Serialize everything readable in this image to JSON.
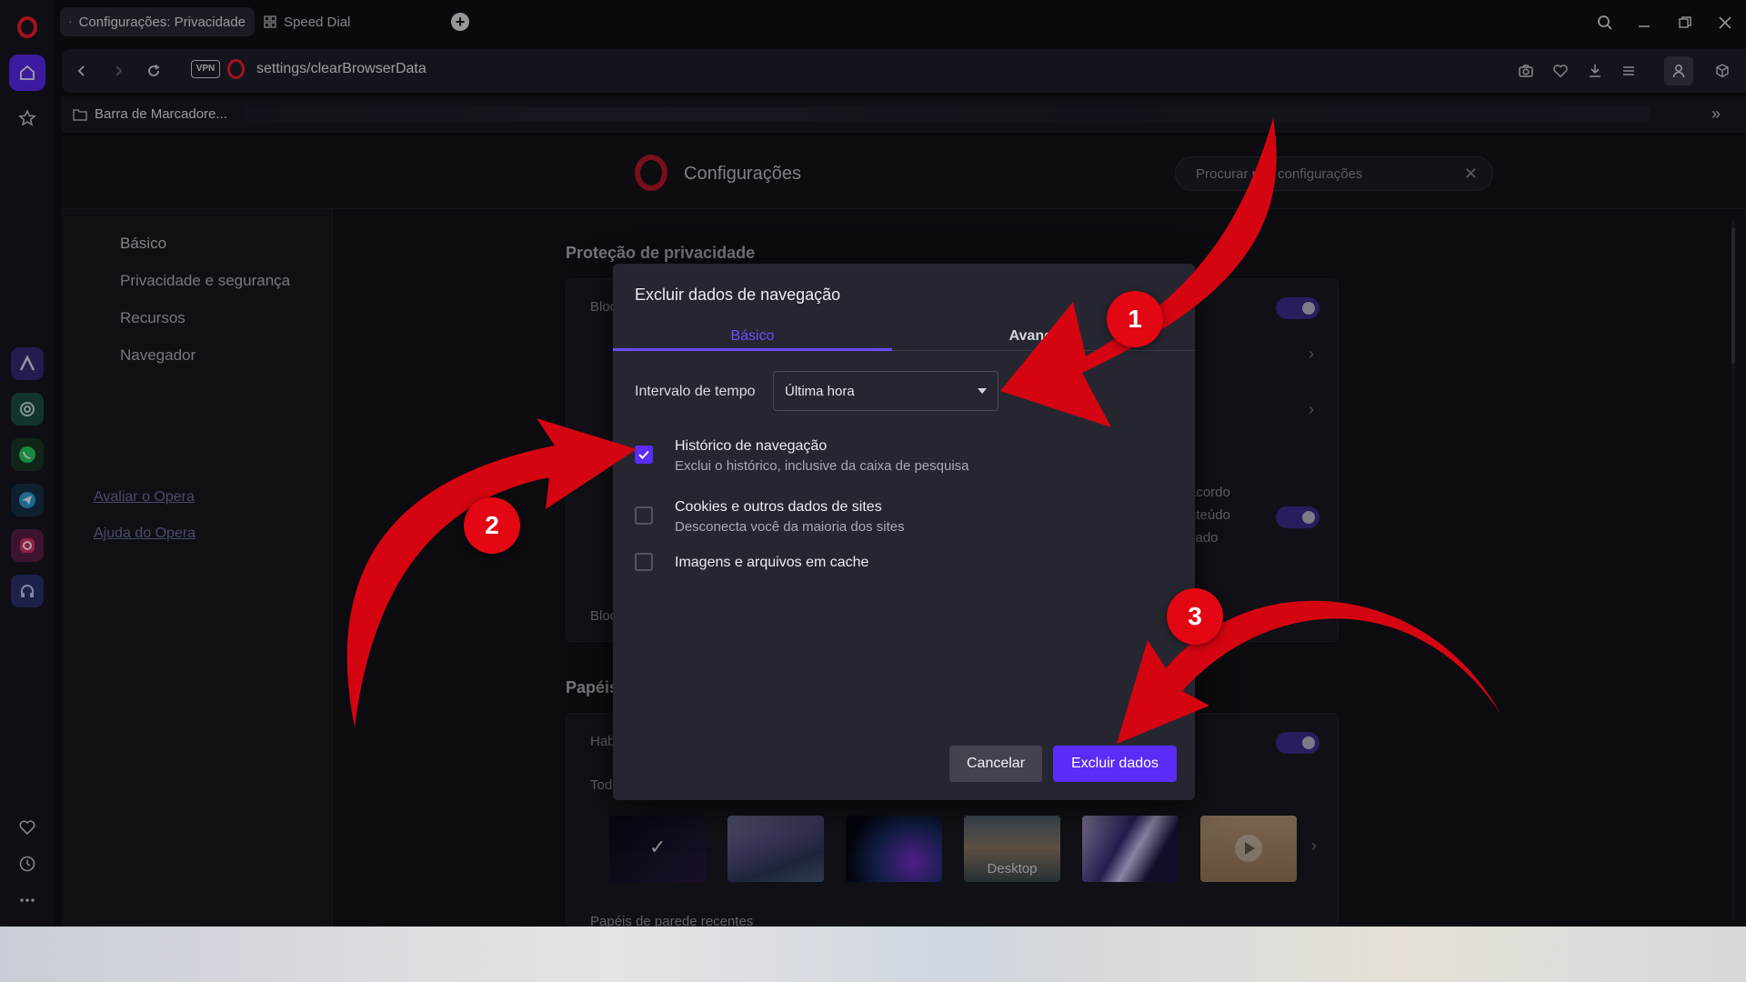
{
  "tabs": [
    {
      "label": "Configurações: Privacidade",
      "icon": "gear-icon"
    },
    {
      "label": "Speed Dial",
      "icon": "grid-icon"
    }
  ],
  "address": {
    "vpn": "VPN",
    "url": "settings/clearBrowserData"
  },
  "bookmarks": {
    "folder": "Barra de Marcadore..."
  },
  "settings": {
    "title": "Configurações",
    "search_placeholder": "Procurar nas configurações",
    "nav": [
      "Básico",
      "Privacidade e segurança",
      "Recursos",
      "Navegador"
    ],
    "links": [
      "Avaliar o Opera",
      "Ajuda do Opera"
    ],
    "section_privacy": "Proteção de privacidade",
    "section_wallpapers": "Papéis",
    "partial_texts": {
      "block1": "Bloc",
      "block2": "Bloc",
      "hab": "Hab",
      "tod": "Tod",
      "acordo": "acordo",
      "conteudo": "nteúdo",
      "vado": "vado"
    },
    "wallpaper_desktop_label": "Desktop",
    "recent_wallpapers": "Papéis de parede recentes"
  },
  "dialog": {
    "title": "Excluir dados de navegação",
    "tab_basic": "Básico",
    "tab_advanced": "Avançado",
    "time_label": "Intervalo de tempo",
    "time_value": "Última hora",
    "options": [
      {
        "title": "Histórico de navegação",
        "subtitle": "Exclui o histórico, inclusive da caixa de pesquisa",
        "checked": true
      },
      {
        "title": "Cookies e outros dados de sites",
        "subtitle": "Desconecta você da maioria dos sites",
        "checked": false
      },
      {
        "title": "Imagens e arquivos em cache",
        "subtitle": "",
        "checked": false
      }
    ],
    "cancel": "Cancelar",
    "confirm": "Excluir dados"
  },
  "annotations": [
    "1",
    "2",
    "3"
  ],
  "colors": {
    "accent": "#5b2cf5",
    "opera_red": "#ff1b2d",
    "annotation_red": "#e30613"
  }
}
